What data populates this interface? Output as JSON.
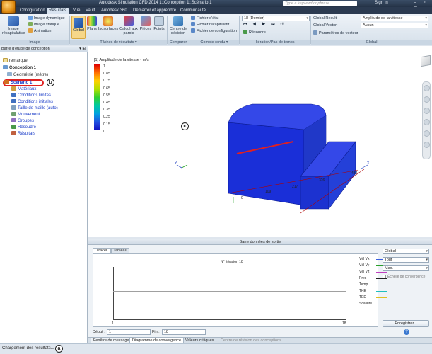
{
  "titlebar": {
    "title": "Autodesk Simulation CFD 2014   1::Conception 1::Scénario 1",
    "search_placeholder": "Type a keyword or phrase",
    "sign_in": "Sign In"
  },
  "tabs": [
    "Configuration",
    "Résultats",
    "Vue",
    "Vault",
    "Autodesk 360",
    "Démarrer et apprendre",
    "Communauté"
  ],
  "ribbon": {
    "image_group": {
      "big": "Image récapitulative",
      "items": [
        "Image dynamique",
        "Image statique",
        "Animation"
      ],
      "label": "Image"
    },
    "tasks_group": {
      "items": [
        "Global",
        "Plans",
        "Isosurfaces",
        "Calcul aux parois",
        "Pièces",
        "Points"
      ],
      "label": "Tâches de résultats"
    },
    "compare_group": {
      "item": "Centre de décision",
      "label": "Comparer"
    },
    "report_group": {
      "items": [
        "Fichier d'état",
        "Fichier récapitulatif",
        "Fichier de configuration"
      ],
      "label": "Compte rendu"
    },
    "iteration_group": {
      "combo": "18 (Dernier)",
      "resolve": "Résoudre",
      "label": "Itération/Pas de temps"
    },
    "global_group": {
      "result_label": "Global Result:",
      "result_value": "Amplitude de la vitesse",
      "vector_label": "Global Vector:",
      "vector_value": "Aucun",
      "vector_params": "Paramètres de vecteur",
      "label": "Global"
    }
  },
  "left_panel": {
    "header": "Barre d'étude de conception",
    "tree": [
      "remarque",
      "Conception 1",
      "Géométrie (mètre)",
      "Scénario 1",
      "Matériaux",
      "Conditions limites",
      "Conditions initiales",
      "Taille de maille (auto)",
      "Mouvement",
      "Groupes",
      "Résoudre",
      "Résultats"
    ]
  },
  "callouts": {
    "a": "a",
    "b": "b",
    "c": "c"
  },
  "viewport": {
    "legend_title": "[1] Amplitude de la vitesse - m/s",
    "legend_ticks": [
      "1",
      "0.85",
      "0.75",
      "0.65",
      "0.55",
      "0.45",
      "0.35",
      "0.25",
      "0.15",
      "0"
    ],
    "dims": [
      "0",
      "109",
      "217",
      "326",
      "434"
    ],
    "axis_x": "X",
    "axis_y": "Y"
  },
  "bottom_panel": {
    "header": "Barre données de sortie",
    "tabs": [
      "Tracer",
      "Tableau"
    ],
    "chart_title": "N° itération 18",
    "x_start": "1",
    "x_end": "18",
    "series": [
      {
        "name": "Vél Vx",
        "color": "#3a5fe0"
      },
      {
        "name": "Vél Vy",
        "color": "#2aa02a"
      },
      {
        "name": "Vél Vz",
        "color": "#c040c0"
      },
      {
        "name": "Pres",
        "color": "#222222"
      },
      {
        "name": "Temp",
        "color": "#e02020"
      },
      {
        "name": "TKE",
        "color": "#20c0c0"
      },
      {
        "name": "TED",
        "color": "#e0c020"
      },
      {
        "name": "Scalaire",
        "color": "#a0a0a0"
      }
    ],
    "combos": [
      "Global",
      "Tout",
      "Max."
    ],
    "log_scale_label": "Échelle de convergence",
    "start_label": "Début :",
    "start_value": "1",
    "end_label": "Fin :",
    "end_value": "18",
    "save_button": "Enregistrer...",
    "bottom_tabs": [
      "Fenêtre de message",
      "Diagramme de convergence",
      "Valeurs critiques",
      "Centre de révision des conceptions"
    ]
  },
  "status": {
    "text": "Chargement des résultats..."
  }
}
